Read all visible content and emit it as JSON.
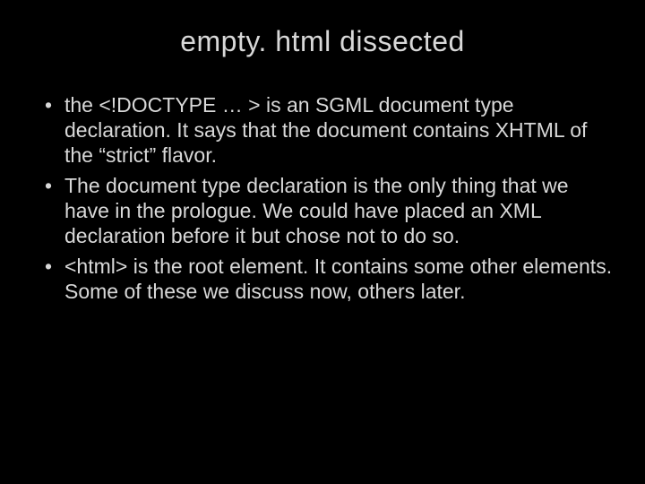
{
  "slide": {
    "title": "empty. html dissected",
    "bullets": [
      "the <!DOCTYPE … > is an SGML document type declaration. It says that the document contains XHTML of the “strict” flavor.",
      "The document type declaration is the only thing that we have in the prologue. We could have placed an XML declaration before it but chose not to do so.",
      "<html> is the root element. It contains some other elements. Some of these we discuss now, others later."
    ]
  }
}
